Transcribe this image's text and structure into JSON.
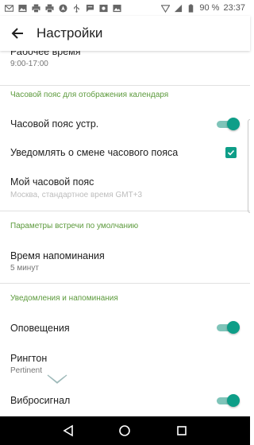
{
  "status_bar": {
    "battery": "90 %",
    "time": "23:37"
  },
  "toolbar": {
    "title": "Настройки"
  },
  "preferences": {
    "work_hours": {
      "title": "Рабочее время",
      "summary": "9:00-17:00"
    },
    "tz_category": "Часовой пояс для отображения календаря",
    "device_tz": {
      "title": "Часовой пояс устр.",
      "checked": true
    },
    "notify_tz_change": {
      "title": "Уведомлять о смене часового пояса",
      "checked": true
    },
    "my_tz": {
      "title": "Мой часовой пояс",
      "summary": "Москва, стандартное время  GMT+3"
    },
    "meeting_category": "Параметры встречи по умолчанию",
    "reminder_time": {
      "title": "Время напоминания",
      "summary": "5 минут"
    },
    "notif_category": "Уведомления и напоминания",
    "alerts": {
      "title": "Оповещения",
      "checked": true
    },
    "ringtone": {
      "title": "Рингтон",
      "summary": "Pertinent"
    },
    "vibration": {
      "title": "Вибросигнал",
      "checked": true
    }
  },
  "colors": {
    "accent": "#0e9e88",
    "category": "#5c9a3c"
  }
}
